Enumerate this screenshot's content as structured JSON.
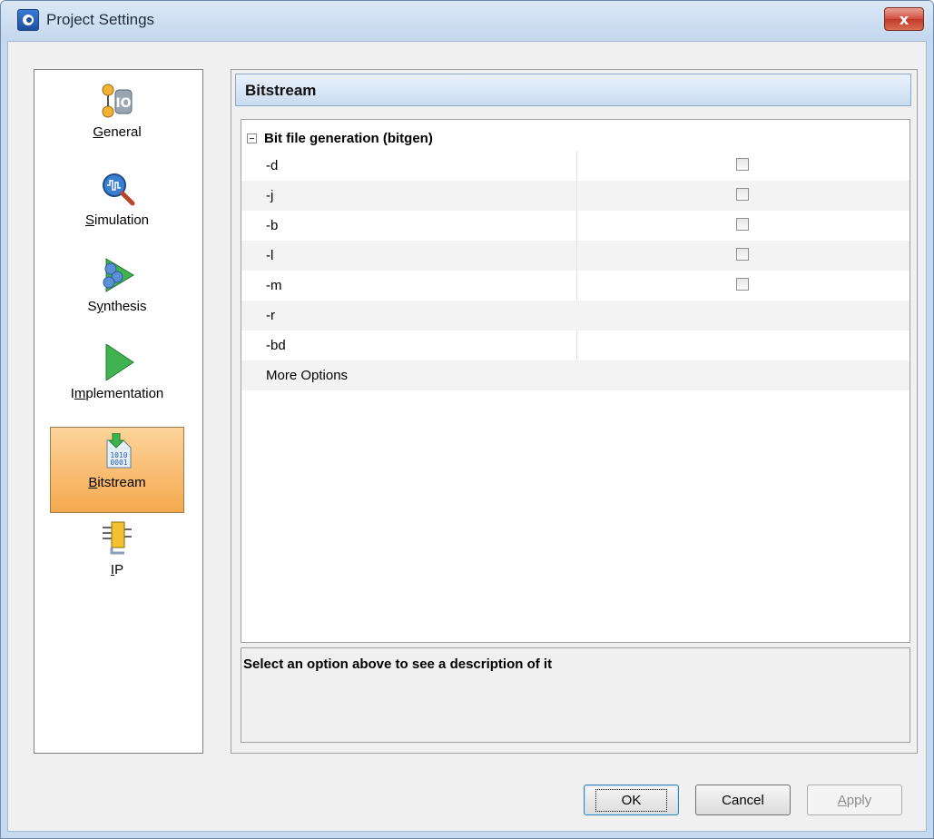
{
  "window": {
    "title": "Project Settings",
    "close_label": "x"
  },
  "nav": {
    "items": [
      {
        "label": "General",
        "mnemonic": "G",
        "rest": "eneral",
        "icon": "general-icon"
      },
      {
        "label": "Simulation",
        "mnemonic": "S",
        "rest": "imulation",
        "icon": "simulation-icon"
      },
      {
        "label": "Synthesis",
        "pre": "S",
        "mnemonic": "y",
        "rest": "nthesis",
        "icon": "synthesis-icon"
      },
      {
        "label": "Implementation",
        "pre": "I",
        "mnemonic": "m",
        "rest": "plementation",
        "icon": "implementation-icon"
      },
      {
        "label": "Bitstream",
        "mnemonic": "B",
        "rest": "itstream",
        "icon": "bitstream-icon",
        "selected": true,
        "icon_text_1": "1010",
        "icon_text_2": "0001"
      },
      {
        "label": "IP",
        "mnemonic": "I",
        "rest": "P",
        "icon": "ip-icon"
      }
    ]
  },
  "panel": {
    "title": "Bitstream",
    "group_label": "Bit file generation (bitgen)",
    "rows": [
      {
        "name": "-d",
        "checkbox": true,
        "checked": false
      },
      {
        "name": "-j",
        "checkbox": true,
        "checked": false
      },
      {
        "name": "-b",
        "checkbox": true,
        "checked": false
      },
      {
        "name": "-l",
        "checkbox": true,
        "checked": false
      },
      {
        "name": "-m",
        "checkbox": true,
        "checked": false
      },
      {
        "name": "-r",
        "checkbox": false
      },
      {
        "name": "-bd",
        "checkbox": false
      },
      {
        "name": "More Options",
        "checkbox": false
      }
    ],
    "description": "Select an option above to see a description of it"
  },
  "buttons": {
    "ok": "OK",
    "cancel": "Cancel",
    "apply_mnemonic": "A",
    "apply_rest": "pply"
  },
  "colors": {
    "selected_nav": "#f5a94e",
    "header": "#c9dcf0",
    "window_frame": "#c6d9ee"
  }
}
